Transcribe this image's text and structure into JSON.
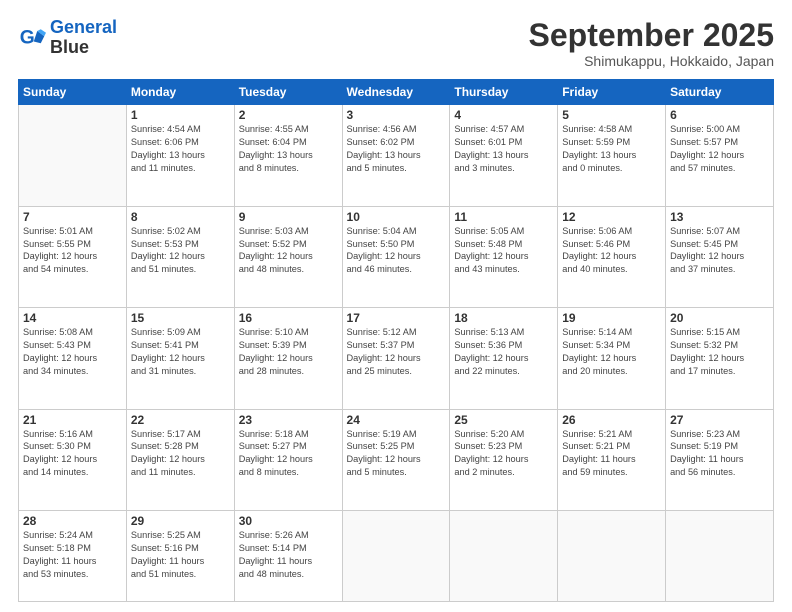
{
  "header": {
    "logo_line1": "General",
    "logo_line2": "Blue",
    "month": "September 2025",
    "location": "Shimukappu, Hokkaido, Japan"
  },
  "weekdays": [
    "Sunday",
    "Monday",
    "Tuesday",
    "Wednesday",
    "Thursday",
    "Friday",
    "Saturday"
  ],
  "weeks": [
    [
      {
        "day": "",
        "info": ""
      },
      {
        "day": "1",
        "info": "Sunrise: 4:54 AM\nSunset: 6:06 PM\nDaylight: 13 hours\nand 11 minutes."
      },
      {
        "day": "2",
        "info": "Sunrise: 4:55 AM\nSunset: 6:04 PM\nDaylight: 13 hours\nand 8 minutes."
      },
      {
        "day": "3",
        "info": "Sunrise: 4:56 AM\nSunset: 6:02 PM\nDaylight: 13 hours\nand 5 minutes."
      },
      {
        "day": "4",
        "info": "Sunrise: 4:57 AM\nSunset: 6:01 PM\nDaylight: 13 hours\nand 3 minutes."
      },
      {
        "day": "5",
        "info": "Sunrise: 4:58 AM\nSunset: 5:59 PM\nDaylight: 13 hours\nand 0 minutes."
      },
      {
        "day": "6",
        "info": "Sunrise: 5:00 AM\nSunset: 5:57 PM\nDaylight: 12 hours\nand 57 minutes."
      }
    ],
    [
      {
        "day": "7",
        "info": "Sunrise: 5:01 AM\nSunset: 5:55 PM\nDaylight: 12 hours\nand 54 minutes."
      },
      {
        "day": "8",
        "info": "Sunrise: 5:02 AM\nSunset: 5:53 PM\nDaylight: 12 hours\nand 51 minutes."
      },
      {
        "day": "9",
        "info": "Sunrise: 5:03 AM\nSunset: 5:52 PM\nDaylight: 12 hours\nand 48 minutes."
      },
      {
        "day": "10",
        "info": "Sunrise: 5:04 AM\nSunset: 5:50 PM\nDaylight: 12 hours\nand 46 minutes."
      },
      {
        "day": "11",
        "info": "Sunrise: 5:05 AM\nSunset: 5:48 PM\nDaylight: 12 hours\nand 43 minutes."
      },
      {
        "day": "12",
        "info": "Sunrise: 5:06 AM\nSunset: 5:46 PM\nDaylight: 12 hours\nand 40 minutes."
      },
      {
        "day": "13",
        "info": "Sunrise: 5:07 AM\nSunset: 5:45 PM\nDaylight: 12 hours\nand 37 minutes."
      }
    ],
    [
      {
        "day": "14",
        "info": "Sunrise: 5:08 AM\nSunset: 5:43 PM\nDaylight: 12 hours\nand 34 minutes."
      },
      {
        "day": "15",
        "info": "Sunrise: 5:09 AM\nSunset: 5:41 PM\nDaylight: 12 hours\nand 31 minutes."
      },
      {
        "day": "16",
        "info": "Sunrise: 5:10 AM\nSunset: 5:39 PM\nDaylight: 12 hours\nand 28 minutes."
      },
      {
        "day": "17",
        "info": "Sunrise: 5:12 AM\nSunset: 5:37 PM\nDaylight: 12 hours\nand 25 minutes."
      },
      {
        "day": "18",
        "info": "Sunrise: 5:13 AM\nSunset: 5:36 PM\nDaylight: 12 hours\nand 22 minutes."
      },
      {
        "day": "19",
        "info": "Sunrise: 5:14 AM\nSunset: 5:34 PM\nDaylight: 12 hours\nand 20 minutes."
      },
      {
        "day": "20",
        "info": "Sunrise: 5:15 AM\nSunset: 5:32 PM\nDaylight: 12 hours\nand 17 minutes."
      }
    ],
    [
      {
        "day": "21",
        "info": "Sunrise: 5:16 AM\nSunset: 5:30 PM\nDaylight: 12 hours\nand 14 minutes."
      },
      {
        "day": "22",
        "info": "Sunrise: 5:17 AM\nSunset: 5:28 PM\nDaylight: 12 hours\nand 11 minutes."
      },
      {
        "day": "23",
        "info": "Sunrise: 5:18 AM\nSunset: 5:27 PM\nDaylight: 12 hours\nand 8 minutes."
      },
      {
        "day": "24",
        "info": "Sunrise: 5:19 AM\nSunset: 5:25 PM\nDaylight: 12 hours\nand 5 minutes."
      },
      {
        "day": "25",
        "info": "Sunrise: 5:20 AM\nSunset: 5:23 PM\nDaylight: 12 hours\nand 2 minutes."
      },
      {
        "day": "26",
        "info": "Sunrise: 5:21 AM\nSunset: 5:21 PM\nDaylight: 11 hours\nand 59 minutes."
      },
      {
        "day": "27",
        "info": "Sunrise: 5:23 AM\nSunset: 5:19 PM\nDaylight: 11 hours\nand 56 minutes."
      }
    ],
    [
      {
        "day": "28",
        "info": "Sunrise: 5:24 AM\nSunset: 5:18 PM\nDaylight: 11 hours\nand 53 minutes."
      },
      {
        "day": "29",
        "info": "Sunrise: 5:25 AM\nSunset: 5:16 PM\nDaylight: 11 hours\nand 51 minutes."
      },
      {
        "day": "30",
        "info": "Sunrise: 5:26 AM\nSunset: 5:14 PM\nDaylight: 11 hours\nand 48 minutes."
      },
      {
        "day": "",
        "info": ""
      },
      {
        "day": "",
        "info": ""
      },
      {
        "day": "",
        "info": ""
      },
      {
        "day": "",
        "info": ""
      }
    ]
  ]
}
